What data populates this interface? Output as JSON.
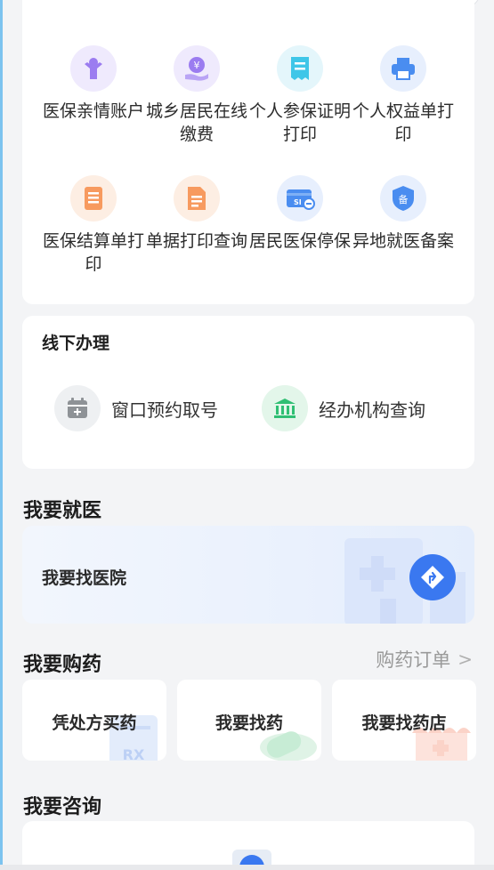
{
  "services": [
    {
      "label": "医保亲情账户",
      "icon": "family-child-icon",
      "color": "#9b7cf0",
      "bg": "#efeafd"
    },
    {
      "label": "城乡居民在线缴费",
      "icon": "yuan-hand-icon",
      "color": "#9b7cf0",
      "bg": "#efeafd"
    },
    {
      "label": "个人参保证明打印",
      "icon": "receipt-icon",
      "color": "#3fc6e8",
      "bg": "#e4f6fb"
    },
    {
      "label": "个人权益单打印",
      "icon": "printer-icon",
      "color": "#4a8df0",
      "bg": "#e7effd"
    },
    {
      "label": "医保结算单打印",
      "icon": "list-document-icon",
      "color": "#f79a5f",
      "bg": "#fdeee3"
    },
    {
      "label": "单据打印查询",
      "icon": "document-search-icon",
      "color": "#f79a5f",
      "bg": "#fdeee3"
    },
    {
      "label": "居民医保停保",
      "icon": "si-card-minus-icon",
      "color": "#4a8df0",
      "bg": "#e7effd"
    },
    {
      "label": "异地就医备案",
      "icon": "shield-record-icon",
      "color": "#4a8df0",
      "bg": "#e7effd"
    }
  ],
  "offline": {
    "title": "线下办理",
    "items": [
      {
        "label": "窗口预约取号",
        "icon": "calendar-plus-icon"
      },
      {
        "label": "经办机构查询",
        "icon": "bank-building-icon"
      }
    ]
  },
  "medical": {
    "title": "我要就医",
    "hospital_label": "我要找医院"
  },
  "drugs": {
    "title": "我要购药",
    "orders_link": "购药订单",
    "cards": [
      {
        "label": "凭处方买药",
        "icon": "prescription-rx-icon"
      },
      {
        "label": "我要找药",
        "icon": "pill-icon"
      },
      {
        "label": "我要找药店",
        "icon": "pharmacy-store-icon"
      }
    ]
  },
  "consult": {
    "title": "我要咨询"
  },
  "colors": {
    "accent_blue": "#3a78f0",
    "offline_green": "#2fbf73"
  }
}
